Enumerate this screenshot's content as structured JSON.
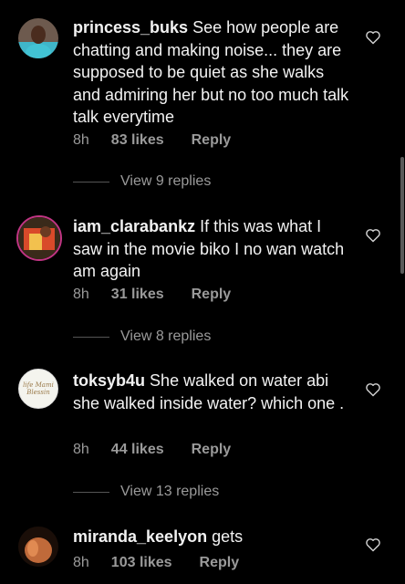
{
  "comments": [
    {
      "username": "princess_buks",
      "text": "See how people are chatting and making noise... they are supposed to be quiet as she walks and admiring her but no too much talk talk everytime",
      "time": "8h",
      "likes": "83 likes",
      "reply": "Reply",
      "view_replies": "View 9 replies"
    },
    {
      "username": "iam_clarabankz",
      "text": "If this was what I saw in the movie biko I no wan watch am again",
      "time": "8h",
      "likes": "31 likes",
      "reply": "Reply",
      "view_replies": "View 8 replies"
    },
    {
      "username": "toksyb4u",
      "text": "She walked on water abi she walked inside water? which one .",
      "time": "8h",
      "likes": "44 likes",
      "reply": "Reply",
      "view_replies": "View 13 replies"
    },
    {
      "username": "miranda_keelyon",
      "text": "gets",
      "time": "8h",
      "likes": "103 likes",
      "reply": "Reply"
    }
  ],
  "avatar3_text": "life Mami Blessin",
  "colors": {
    "background": "#000000",
    "meta": "#9a9a9a",
    "text": "#f2f2f2"
  }
}
